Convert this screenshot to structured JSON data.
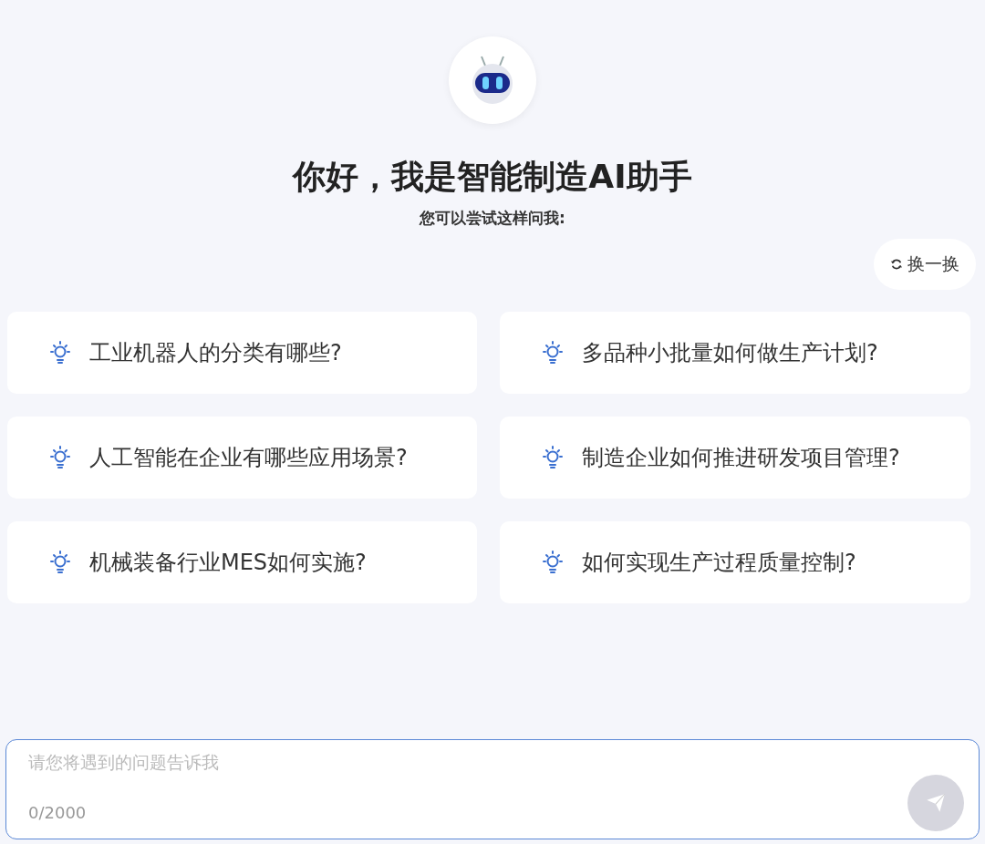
{
  "title": "你好，我是智能制造AI助手",
  "subtitle": "您可以尝试这样问我:",
  "refresh_button": "换一换",
  "suggestions": [
    {
      "text": "工业机器人的分类有哪些?"
    },
    {
      "text": "多品种小批量如何做生产计划?"
    },
    {
      "text": "人工智能在企业有哪些应用场景?"
    },
    {
      "text": "制造企业如何推进研发项目管理?"
    },
    {
      "text": "机械装备行业MES如何实施?"
    },
    {
      "text": "如何实现生产过程质量控制?"
    }
  ],
  "input": {
    "placeholder": "请您将遇到的问题告诉我",
    "counter": "0/2000",
    "send_disabled": true
  }
}
